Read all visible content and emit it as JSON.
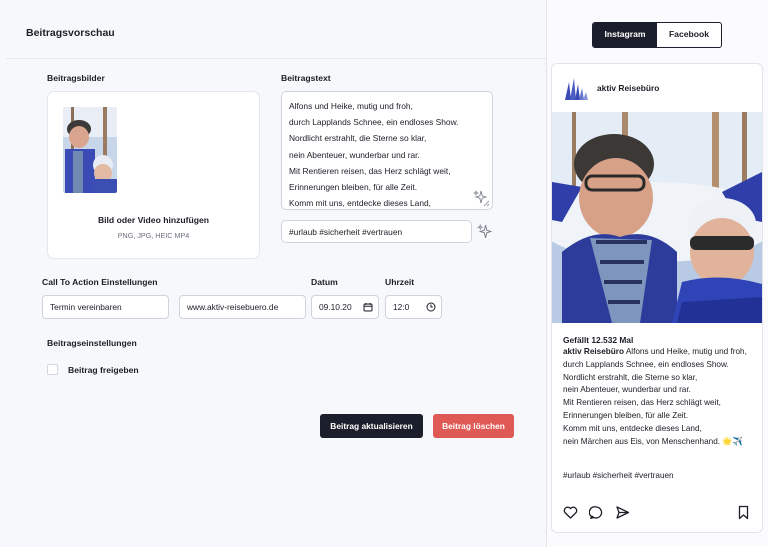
{
  "preview": {
    "title": "Beitragsvorschau"
  },
  "images": {
    "label": "Beitragsbilder",
    "add_label": "Bild oder Video hinzufügen",
    "formats": "PNG, JPG, HEIC MP4"
  },
  "text": {
    "label": "Beitragstext",
    "lines": [
      "Alfons und Heike, mutig und froh,",
      "durch Lapplands Schnee, ein endloses Show.",
      "Nordlicht erstrahlt, die Sterne so klar,",
      "nein Abenteuer, wunderbar und rar.",
      "Mit Rentieren reisen, das Herz schlägt weit,",
      "Erinnerungen bleiben, für alle Zeit.",
      "Komm mit uns, entdecke dieses Land,"
    ],
    "hashtags": "#urlaub #sicherheit #vertrauen"
  },
  "cta": {
    "label": "Call To Action Einstellungen",
    "action": "Termin vereinbaren",
    "url": "www.aktiv-reisebuero.de",
    "date_label": "Datum",
    "date": "09.10.20",
    "time_label": "Uhrzeit",
    "time": "12:0"
  },
  "settings": {
    "label": "Beitragseinstellungen",
    "release_label": "Beitrag freigeben"
  },
  "buttons": {
    "update": "Beitrag aktualisieren",
    "delete": "Beitrag löschen"
  },
  "tabs": [
    "Instagram",
    "Facebook"
  ],
  "post": {
    "account": "aktiv Reisebüro",
    "likes": "Gefällt 12.532 Mal",
    "caption_lines": [
      "Alfons und Heike, mutig und froh,",
      "durch Lapplands Schnee, ein endloses Show.",
      "Nordlicht erstrahlt, die Sterne so klar,",
      "nein Abenteuer, wunderbar und rar.",
      "Mit Rentieren reisen, das Herz schlägt weit,",
      "Erinnerungen bleiben, für alle Zeit.",
      "Komm mit uns, entdecke dieses Land,",
      "nein Märchen aus Eis, von Menschenhand. 🌟✈️"
    ],
    "hashtags": "#urlaub #sicherheit #vertrauen"
  },
  "icons": [
    "sparkle-icon",
    "calendar-icon",
    "clock-icon",
    "heart-icon",
    "comment-icon",
    "share-icon",
    "bookmark-icon"
  ],
  "colors": {
    "dark": "#1b1e2b",
    "danger": "#e05a55",
    "brand_blue": "#3a4bb5"
  }
}
